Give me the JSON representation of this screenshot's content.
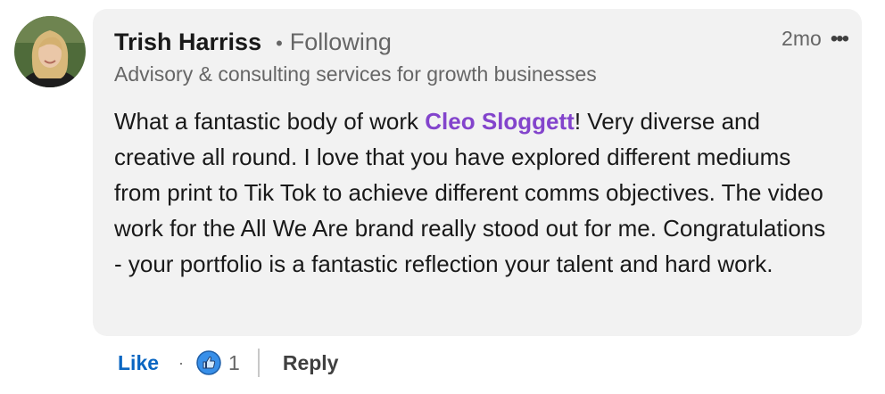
{
  "comment": {
    "author": {
      "name": "Trish Harriss",
      "separator": "•",
      "relationship": "Following",
      "headline": "Advisory & consulting services for growth businesses",
      "avatar_icon": "profile-photo"
    },
    "timestamp": "2mo",
    "more_icon": "ellipsis-horizontal-icon",
    "text_before": "What a fantastic body of work ",
    "mention": "Cleo Sloggett",
    "text_after": "! Very diverse and creative all round. I love that you have explored different mediums from print to Tik Tok to achieve different comms objectives. The video work for the All We Are brand really stood out for me. Congratulations - your portfolio is a fantastic reflection your talent and hard work."
  },
  "actions": {
    "like_label": "Like",
    "dot": "·",
    "reaction_icon": "thumbs-up-icon",
    "reaction_count": "1",
    "reply_label": "Reply"
  },
  "colors": {
    "bubble_bg": "#f2f2f2",
    "mention": "#8344cc",
    "like_blue": "#0a66c2",
    "muted_text": "#666666"
  }
}
